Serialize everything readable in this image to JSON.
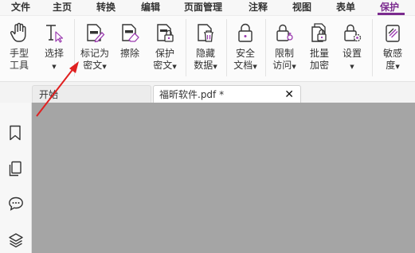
{
  "menu": {
    "items": [
      "文件",
      "主页",
      "转换",
      "编辑",
      "页面管理",
      "注释",
      "视图",
      "表单",
      "保护"
    ],
    "active": "保护",
    "accent_color": "#7b2b8f"
  },
  "ribbon": {
    "hand_tool": {
      "line1": "手型",
      "line2": "工具",
      "icon": "hand-icon"
    },
    "select": {
      "line1": "选择",
      "arrow": "▼",
      "icon": "text-select-icon"
    },
    "mark_redact": {
      "line1": "标记为",
      "line2": "密文",
      "arrow": "▼",
      "icon": "mark-redaction-icon"
    },
    "erase": {
      "line1": "擦除",
      "icon": "eraser-icon"
    },
    "protect_redact": {
      "line1": "保护",
      "line2": "密文",
      "arrow": "▼",
      "icon": "protect-redaction-icon"
    },
    "hide_data": {
      "line1": "隐藏",
      "line2": "数据",
      "arrow": "▼",
      "icon": "trash-icon"
    },
    "secure_doc": {
      "line1": "安全",
      "line2": "文档",
      "arrow": "▼",
      "icon": "lock-icon"
    },
    "restrict": {
      "line1": "限制",
      "line2": "访问",
      "arrow": "▼",
      "icon": "restrict-access-icon"
    },
    "batch_encrypt": {
      "line1": "批量",
      "line2": "加密",
      "icon": "batch-encrypt-icon"
    },
    "settings": {
      "line1": "设置",
      "arrow": "▼",
      "icon": "lock-settings-icon"
    },
    "sensitivity": {
      "line1": "敏感",
      "line2": "度",
      "arrow": "▼",
      "icon": "sensitivity-icon"
    }
  },
  "tabs": {
    "home": "开始",
    "doc": "福昕软件.pdf *",
    "close": "✕"
  },
  "sidebar": {
    "icons": [
      "bookmark-icon",
      "pages-icon",
      "comment-icon",
      "layers-icon"
    ]
  },
  "annotation": {
    "arrow_color": "#e02020"
  }
}
